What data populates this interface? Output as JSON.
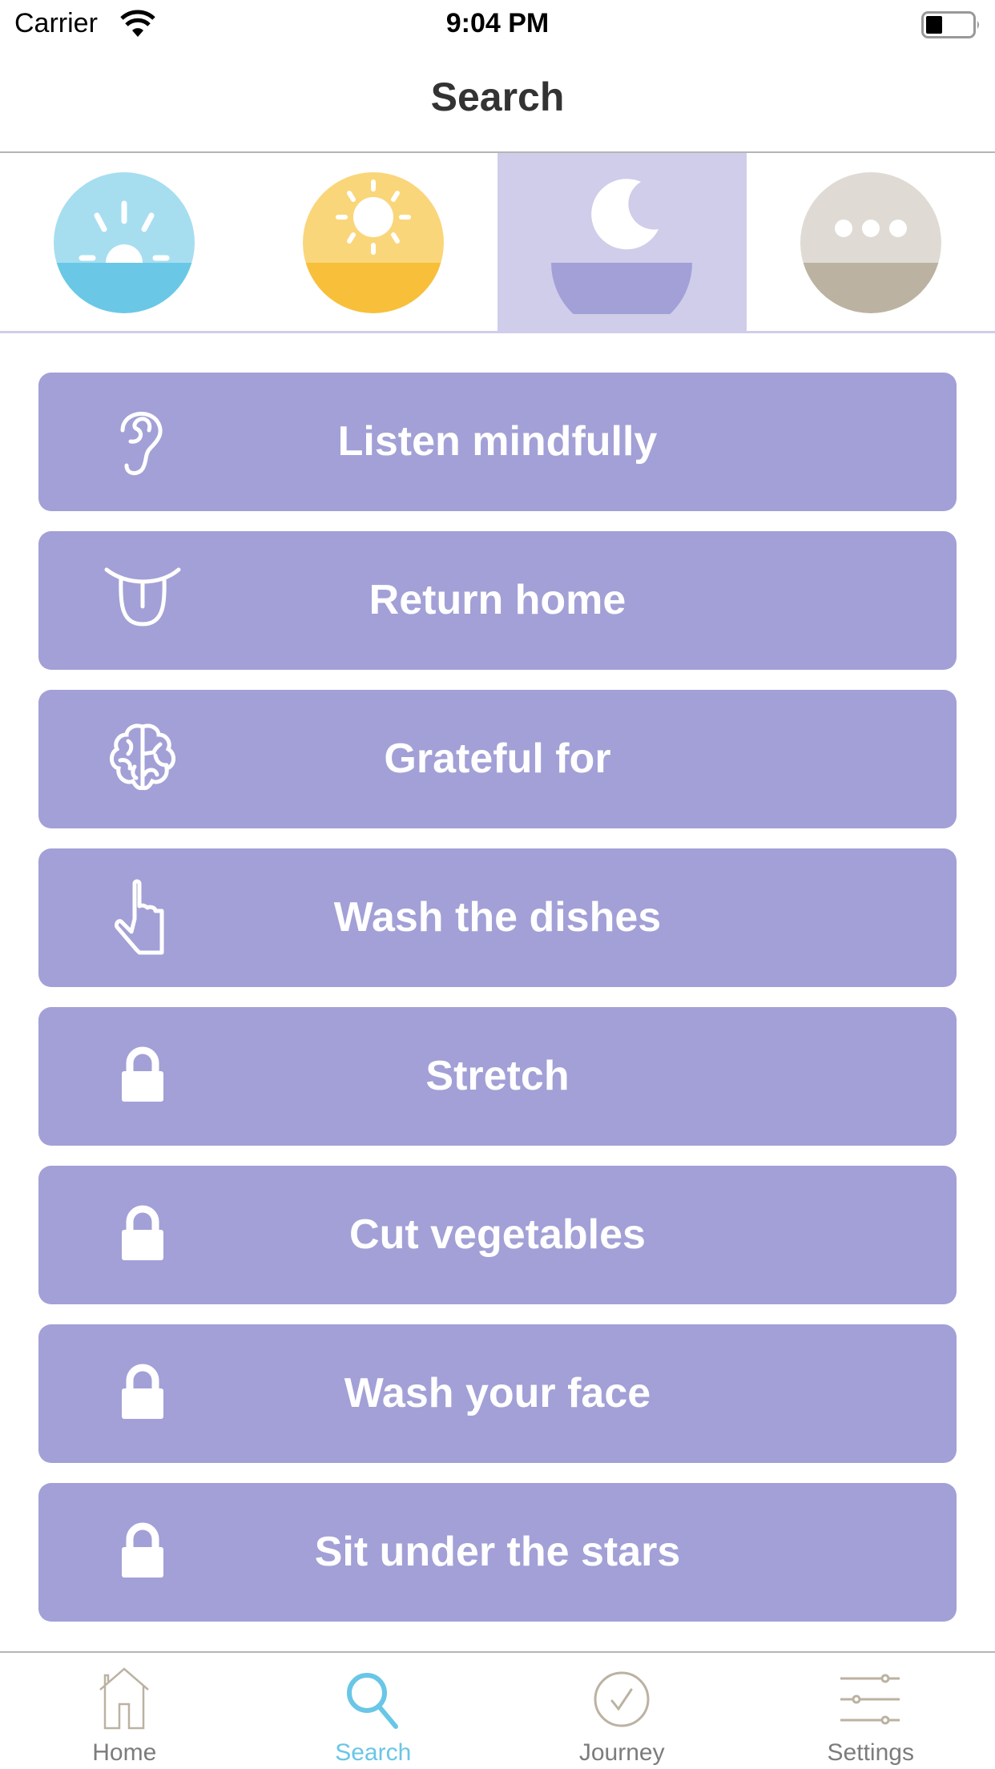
{
  "status_bar": {
    "carrier": "Carrier",
    "time": "9:04 PM",
    "wifi_icon": "wifi-icon",
    "battery_icon": "battery-icon"
  },
  "header": {
    "title": "Search"
  },
  "categories": [
    {
      "name": "sunrise",
      "icon": "sunrise-icon",
      "top_color": "#a6def0",
      "bottom_color": "#6ac8e6",
      "selected": false
    },
    {
      "name": "midday",
      "icon": "sun-icon",
      "top_color": "#fad67a",
      "bottom_color": "#f8bf3a",
      "selected": false
    },
    {
      "name": "night",
      "icon": "moon-icon",
      "top_color": "#cfcdea",
      "bottom_color": "#a2a0d6",
      "selected": true
    },
    {
      "name": "more",
      "icon": "more-icon",
      "top_color": "#dfdbd4",
      "bottom_color": "#bbb2a2",
      "selected": false
    }
  ],
  "activities": [
    {
      "label": "Listen mindfully",
      "icon": "ear-icon",
      "locked": false
    },
    {
      "label": "Return home",
      "icon": "tongue-icon",
      "locked": false
    },
    {
      "label": "Grateful for",
      "icon": "brain-icon",
      "locked": false
    },
    {
      "label": "Wash the dishes",
      "icon": "hand-pointer-icon",
      "locked": false
    },
    {
      "label": "Stretch",
      "icon": "lock-icon",
      "locked": true
    },
    {
      "label": "Cut vegetables",
      "icon": "lock-icon",
      "locked": true
    },
    {
      "label": "Wash your face",
      "icon": "lock-icon",
      "locked": true
    },
    {
      "label": "Sit under the stars",
      "icon": "lock-icon",
      "locked": true
    }
  ],
  "tab_bar": {
    "tabs": [
      {
        "label": "Home",
        "icon": "home-icon",
        "active": false
      },
      {
        "label": "Search",
        "icon": "search-icon",
        "active": true
      },
      {
        "label": "Journey",
        "icon": "checkmark-circle-icon",
        "active": false
      },
      {
        "label": "Settings",
        "icon": "sliders-icon",
        "active": false
      }
    ]
  },
  "colors": {
    "card_background": "#a2a0d6",
    "selected_category_background": "#cfcdea",
    "active_tab": "#69c6e6",
    "inactive_tab_icon": "#bbb2a2",
    "inactive_tab_label": "#7c7c7c"
  }
}
